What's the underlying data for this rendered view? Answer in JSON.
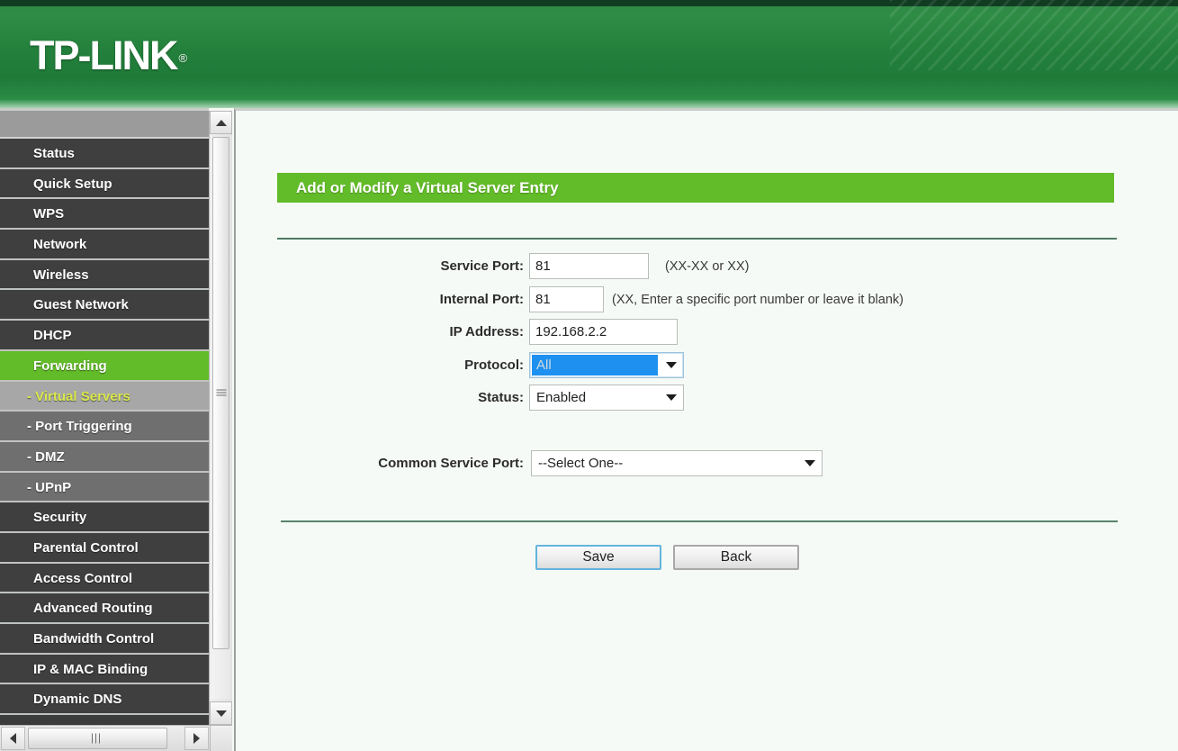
{
  "header": {
    "brand": "TP-LINK",
    "registered_mark": "®"
  },
  "sidebar": {
    "items": [
      {
        "label": "Status",
        "type": "main",
        "state": "normal"
      },
      {
        "label": "Quick Setup",
        "type": "main",
        "state": "normal"
      },
      {
        "label": "WPS",
        "type": "main",
        "state": "normal"
      },
      {
        "label": "Network",
        "type": "main",
        "state": "normal"
      },
      {
        "label": "Wireless",
        "type": "main",
        "state": "normal"
      },
      {
        "label": "Guest Network",
        "type": "main",
        "state": "normal"
      },
      {
        "label": "DHCP",
        "type": "main",
        "state": "normal"
      },
      {
        "label": "Forwarding",
        "type": "main",
        "state": "active"
      },
      {
        "label": "- Virtual Servers",
        "type": "sub",
        "state": "subactive"
      },
      {
        "label": "- Port Triggering",
        "type": "sub",
        "state": "normal"
      },
      {
        "label": "- DMZ",
        "type": "sub",
        "state": "normal"
      },
      {
        "label": "- UPnP",
        "type": "sub",
        "state": "normal"
      },
      {
        "label": "Security",
        "type": "main",
        "state": "normal"
      },
      {
        "label": "Parental Control",
        "type": "main",
        "state": "normal"
      },
      {
        "label": "Access Control",
        "type": "main",
        "state": "normal"
      },
      {
        "label": "Advanced Routing",
        "type": "main",
        "state": "normal"
      },
      {
        "label": "Bandwidth Control",
        "type": "main",
        "state": "normal"
      },
      {
        "label": "IP & MAC Binding",
        "type": "main",
        "state": "normal"
      },
      {
        "label": "Dynamic DNS",
        "type": "main",
        "state": "normal"
      }
    ],
    "scroll": {
      "up_icon": "triangle-up-icon",
      "down_icon": "triangle-down-icon",
      "left_icon": "triangle-left-icon",
      "right_icon": "triangle-right-icon"
    }
  },
  "main": {
    "panel_title": "Add or Modify a Virtual Server Entry",
    "fields": {
      "service_port": {
        "label": "Service Port:",
        "value": "81",
        "placeholder": "",
        "hint": "(XX-XX or XX)"
      },
      "internal_port": {
        "label": "Internal Port:",
        "value": "81",
        "placeholder": "",
        "hint": "(XX, Enter a specific port number or leave it blank)"
      },
      "ip_address": {
        "label": "IP Address:",
        "value": "192.168.2.2",
        "placeholder": "",
        "hint": ""
      },
      "protocol": {
        "label": "Protocol:",
        "value": "All",
        "focused": true
      },
      "status": {
        "label": "Status:",
        "value": "Enabled",
        "focused": false
      },
      "common_service_port": {
        "label": "Common Service Port:",
        "value": "--Select One--",
        "focused": false
      }
    },
    "buttons": {
      "save": "Save",
      "back": "Back"
    }
  },
  "colors": {
    "brand_green": "#62bb28",
    "header_green": "#238140",
    "sidebar_dark": "#3f3f3f",
    "sidebar_sub": "#6f6f6f",
    "sidebar_subactive_bg": "#a7a7a7",
    "sidebar_subactive_text": "#d9e84a",
    "select_highlight_blue": "#1e90ef",
    "focus_ring_blue": "#64b4dd",
    "divider_green": "#4f7a62",
    "content_bg": "#f6faf6"
  }
}
